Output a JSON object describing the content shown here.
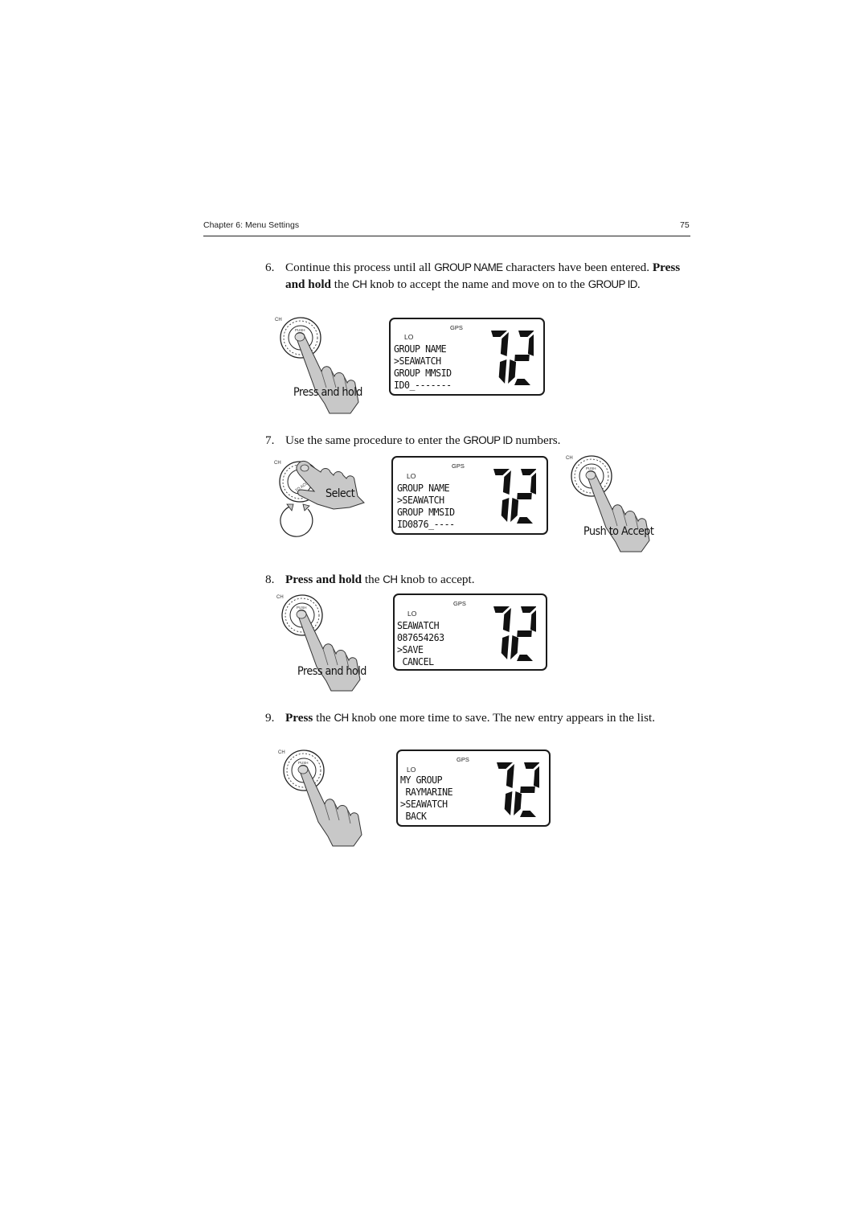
{
  "header": {
    "chapter": "Chapter 6: Menu Settings",
    "page_number": "75"
  },
  "steps": [
    {
      "number": "6.",
      "text_parts": {
        "a": "Continue this process until all ",
        "b": "GROUP NAME",
        "c": " characters have been entered. ",
        "d": "Press and hold",
        "e": " the ",
        "f": "CH",
        "g": " knob to accept the name and move on to the ",
        "h": "GROUP ID",
        "i": "."
      },
      "illustration": {
        "knob_label": "CH",
        "knob_text": "PUSH",
        "caption": "Press and hold",
        "icon": "hand-press-knob-icon"
      },
      "lcd": {
        "gps": "GPS",
        "lo": "LO",
        "channel": "72",
        "lines": [
          "GROUP NAME",
          ">SEAWATCH",
          "GROUP MMSID",
          "ID0_-------"
        ]
      }
    },
    {
      "number": "7.",
      "text_parts": {
        "a": "Use the same procedure to enter the ",
        "b": "GROUP ID",
        "c": " numbers."
      },
      "illustration_left": {
        "knob_label": "CH",
        "knob_text": "PUSH TO ACCEPT",
        "caption": "Select",
        "icon": "hand-rotate-knob-icon",
        "rotate_icon": "rotate-arrows-icon"
      },
      "illustration_right": {
        "knob_label": "CH",
        "knob_text": "PUSH",
        "caption": "Push to Accept",
        "icon": "hand-press-knob-icon"
      },
      "lcd": {
        "gps": "GPS",
        "lo": "LO",
        "channel": "72",
        "lines": [
          "GROUP NAME",
          ">SEAWATCH",
          "GROUP MMSID",
          "ID0876_----"
        ]
      }
    },
    {
      "number": "8.",
      "text_parts": {
        "a": "Press and hold",
        "b": " the ",
        "c": "CH",
        "d": " knob to accept."
      },
      "illustration": {
        "knob_label": "CH",
        "knob_text": "PUSH",
        "caption": "Press and hold",
        "icon": "hand-press-knob-icon"
      },
      "lcd": {
        "gps": "GPS",
        "lo": "LO",
        "channel": "72",
        "lines": [
          "SEAWATCH",
          "087654263",
          ">SAVE",
          " CANCEL"
        ]
      }
    },
    {
      "number": "9.",
      "text_parts": {
        "a": "Press",
        "b": " the ",
        "c": "CH",
        "d": " knob one more time to save. The new entry appears in the list."
      },
      "illustration": {
        "knob_label": "CH",
        "knob_text": "PUSH",
        "caption": "",
        "icon": "hand-press-knob-icon"
      },
      "lcd": {
        "gps": "GPS",
        "lo": "LO",
        "channel": "72",
        "lines": [
          "MY GROUP",
          " RAYMARINE",
          ">SEAWATCH",
          " BACK"
        ]
      }
    }
  ]
}
